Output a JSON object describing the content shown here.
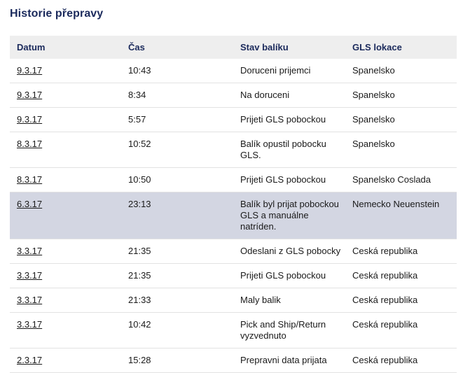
{
  "page": {
    "title": "Historie přepravy"
  },
  "table": {
    "headers": [
      "Datum",
      "Čas",
      "Stav balíku",
      "GLS lokace"
    ],
    "rows": [
      {
        "date": "9.3.17",
        "time": "10:43",
        "status": "Doruceni prijemci",
        "location": "Spanelsko"
      },
      {
        "date": "9.3.17",
        "time": "8:34",
        "status": "Na doruceni",
        "location": "Spanelsko"
      },
      {
        "date": "9.3.17",
        "time": "5:57",
        "status": "Prijeti GLS pobockou",
        "location": "Spanelsko"
      },
      {
        "date": "8.3.17",
        "time": "10:52",
        "status": "Balík opustil pobocku GLS.",
        "location": "Spanelsko"
      },
      {
        "date": "8.3.17",
        "time": "10:50",
        "status": "Prijeti GLS pobockou",
        "location": "Spanelsko Coslada"
      },
      {
        "date": "6.3.17",
        "time": "23:13",
        "status": "Balík byl prijat pobockou GLS a manuálne natríden.",
        "location": "Nemecko Neuenstein"
      },
      {
        "date": "3.3.17",
        "time": "21:35",
        "status": "Odeslani z GLS pobocky",
        "location": "Ceská republika"
      },
      {
        "date": "3.3.17",
        "time": "21:35",
        "status": "Prijeti GLS pobockou",
        "location": "Ceská republika"
      },
      {
        "date": "3.3.17",
        "time": "21:33",
        "status": "Maly balik",
        "location": "Ceská republika"
      },
      {
        "date": "3.3.17",
        "time": "10:42",
        "status": "Pick and Ship/Return vyzvednuto",
        "location": "Ceská republika"
      },
      {
        "date": "2.3.17",
        "time": "15:28",
        "status": "Prepravni data prijata",
        "location": "Ceská republika"
      }
    ]
  },
  "colors": {
    "title": "#1b2a5c",
    "header_bg": "#eeeeee",
    "highlight_row_bg": "#d3d6e2",
    "row_divider": "#e2e2e2"
  }
}
